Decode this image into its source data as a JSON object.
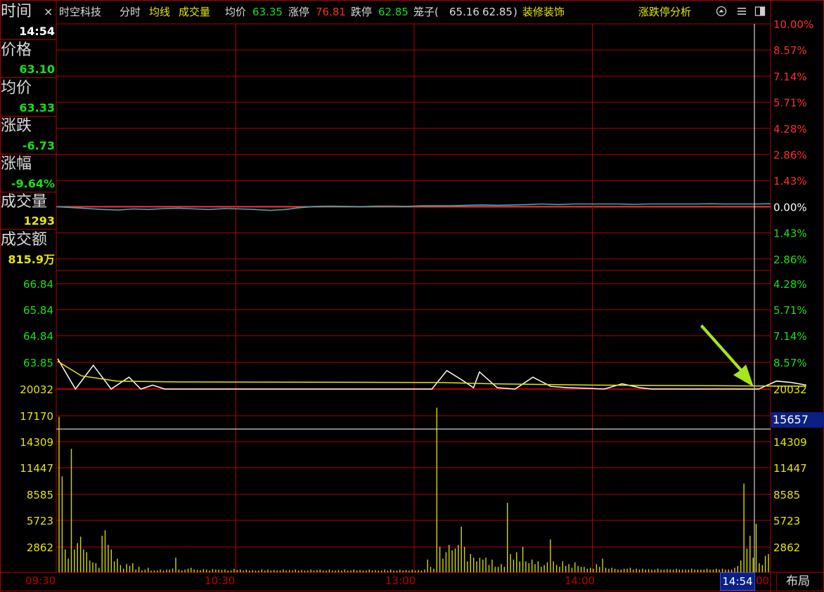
{
  "info_panel": {
    "time_label": "时间",
    "close_glyph": "×",
    "time_value": "14:54",
    "price_label": "价格",
    "price_value": "63.10",
    "avg_label": "均价",
    "avg_value": "63.33",
    "change_label": "涨跌",
    "change_value": "-6.73",
    "pct_label": "涨幅",
    "pct_value": "-9.64%",
    "vol_label": "成交量",
    "vol_value": "1293",
    "amount_label": "成交额",
    "amount_value": "815.9万"
  },
  "header": {
    "stock_name": "时空科技",
    "tab_fenshi": "分时",
    "tab_junxian": "均线",
    "tab_volume": "成交量",
    "avg_price_label": "均价",
    "avg_price_value": "63.35",
    "limit_up_label": "涨停",
    "limit_up_value": "76.81",
    "limit_down_label": "跌停",
    "limit_down_value": "62.85",
    "cage_label": "笼子(",
    "cage_value_1": "65.16",
    "cage_value_2": "62.85",
    "cage_close": ")",
    "sector": "装修装饰",
    "analysis_link": "涨跌停分析"
  },
  "bottom_bar": {
    "time_labels": [
      "09:30",
      "10:30",
      "13:00",
      "14:00"
    ],
    "current_time": "14:54",
    "current_time_tail": "00",
    "layout_button": "布局"
  },
  "crosshair_volume": "15657",
  "colors": {
    "grid": "#b00000",
    "up": "#ff2b2b",
    "down": "#19e019",
    "price_line": "#ffffff",
    "avg_line": "#e6e600",
    "volume": "#d6d600",
    "upper_line": "#2ab3b3",
    "label_yellow": "#e6e600",
    "arrow": "#a6e61a",
    "highlight_bg": "#0b1f84"
  },
  "icons": [
    "page-up-icon",
    "menu-icon",
    "window-toggle-icon"
  ],
  "chart_data": [
    {
      "type": "line",
      "name": "upper-panel",
      "right_axis_ticks": [
        "10.00%",
        "8.57%",
        "7.14%",
        "5.71%",
        "4.28%",
        "2.86%",
        "1.43%",
        "0.00%",
        "1.43%",
        "2.86%"
      ],
      "ylim_pct": [
        -4.2,
        10.0
      ],
      "series": [
        {
          "values_pct": [
            0.0,
            -0.05,
            -0.1,
            -0.15,
            -0.18,
            -0.12,
            -0.15,
            -0.1,
            -0.08,
            -0.12,
            -0.15,
            -0.1,
            -0.12,
            -0.15,
            -0.2,
            -0.15,
            -0.05,
            0.02,
            0.03,
            0.02,
            0.0,
            0.03,
            0.03,
            0.02,
            0.05,
            0.05,
            0.05,
            0.08,
            0.1,
            0.08,
            0.1,
            0.12,
            0.15,
            0.12,
            0.15,
            0.15,
            0.15,
            0.15,
            0.13,
            0.15,
            0.15,
            0.15,
            0.15,
            0.16,
            0.15,
            0.15,
            0.15,
            0.16
          ]
        }
      ]
    },
    {
      "type": "line",
      "name": "price-panel",
      "left_axis_ticks": [
        "66.84",
        "65.84",
        "64.84",
        "63.85",
        "20032"
      ],
      "right_axis_ticks": [
        "4.28%",
        "5.71%",
        "7.14%",
        "8.57%",
        "20032"
      ],
      "ylim": [
        62.6,
        67.2
      ],
      "x_range": [
        "09:30",
        "15:00"
      ],
      "series": [
        {
          "name": "price",
          "points": [
            [
              0,
              64.0
            ],
            [
              6,
              62.85
            ],
            [
              12,
              63.75
            ],
            [
              18,
              62.85
            ],
            [
              24,
              63.3
            ],
            [
              28,
              62.85
            ],
            [
              32,
              63.0
            ],
            [
              36,
              62.85
            ],
            [
              70,
              62.85
            ],
            [
              120,
              62.85
            ],
            [
              126,
              62.85
            ],
            [
              131,
              63.55
            ],
            [
              136,
              63.2
            ],
            [
              140,
              62.9
            ],
            [
              142,
              63.5
            ],
            [
              148,
              62.9
            ],
            [
              154,
              62.85
            ],
            [
              160,
              63.3
            ],
            [
              166,
              62.95
            ],
            [
              172,
              62.9
            ],
            [
              178,
              62.88
            ],
            [
              184,
              62.85
            ],
            [
              190,
              63.05
            ],
            [
              196,
              62.9
            ],
            [
              200,
              62.85
            ],
            [
              236,
              62.85
            ],
            [
              242,
              63.15
            ],
            [
              247,
              63.1
            ],
            [
              252,
              63.0
            ]
          ]
        },
        {
          "name": "avg",
          "points": [
            [
              0,
              63.9
            ],
            [
              8,
              63.35
            ],
            [
              20,
              63.15
            ],
            [
              38,
              63.12
            ],
            [
              120,
              63.1
            ],
            [
              128,
              63.1
            ],
            [
              146,
              63.05
            ],
            [
              180,
              63.0
            ],
            [
              230,
              62.97
            ],
            [
              252,
              62.96
            ]
          ]
        }
      ]
    },
    {
      "type": "bar",
      "name": "volume-panel",
      "left_axis_ticks": [
        "17170",
        "14309",
        "11447",
        "8585",
        "5723",
        "2862"
      ],
      "right_axis_ticks": [
        "14309",
        "11447",
        "8585",
        "5723",
        "2862"
      ],
      "ylim": [
        0,
        20032
      ],
      "x_range": [
        "09:30",
        "15:00"
      ],
      "crosshair_value": 15657,
      "values": [
        17000,
        10500,
        2500,
        1500,
        13500,
        2500,
        3200,
        3900,
        2500,
        2200,
        1300,
        1100,
        1000,
        500,
        4000,
        4600,
        3000,
        2500,
        1200,
        1500,
        800,
        400,
        900,
        700,
        1000,
        300,
        600,
        200,
        300,
        500,
        200,
        200,
        200,
        300,
        200,
        300,
        300,
        400,
        1600,
        300,
        200,
        300,
        400,
        500,
        300,
        250,
        250,
        350,
        300,
        200,
        350,
        300,
        300,
        250,
        300,
        200,
        200,
        400,
        250,
        300,
        200,
        300,
        200,
        250,
        200,
        200,
        300,
        200,
        300,
        200,
        250,
        200,
        200,
        300,
        200,
        250,
        200,
        300,
        200,
        250,
        200,
        200,
        300,
        200,
        250,
        300,
        200,
        200,
        300,
        200,
        200,
        250,
        200,
        300,
        200,
        200,
        300,
        200,
        250,
        200,
        200,
        300,
        200,
        250,
        200,
        200,
        300,
        200,
        300,
        200,
        200,
        300,
        200,
        250,
        200,
        300,
        200,
        250,
        200,
        300,
        1400,
        600,
        400,
        18000,
        2800,
        1500,
        2200,
        3000,
        2400,
        2600,
        3000,
        5000,
        2800,
        1200,
        2000,
        1600,
        1200,
        1600,
        1400,
        1600,
        800,
        1400,
        600,
        600,
        900,
        600,
        7600,
        2000,
        1400,
        2200,
        1200,
        2800,
        1200,
        1000,
        1400,
        900,
        1200,
        600,
        800,
        1100,
        3600,
        1200,
        800,
        600,
        1200,
        700,
        900,
        500,
        1100,
        700,
        600,
        600,
        400,
        500,
        400,
        900,
        600,
        1500,
        500,
        400,
        500,
        400,
        300,
        300,
        400,
        400,
        500,
        300,
        400,
        300,
        400,
        300,
        350,
        300,
        300,
        400,
        300,
        300,
        350,
        300,
        300,
        400,
        300,
        300,
        300,
        300,
        400,
        300,
        300,
        300,
        300,
        400,
        300,
        300,
        400,
        300,
        400,
        300,
        300,
        300,
        500,
        700,
        1300,
        9700,
        2600,
        4000,
        1600,
        5300,
        1000,
        800,
        1800,
        2000
      ]
    }
  ]
}
